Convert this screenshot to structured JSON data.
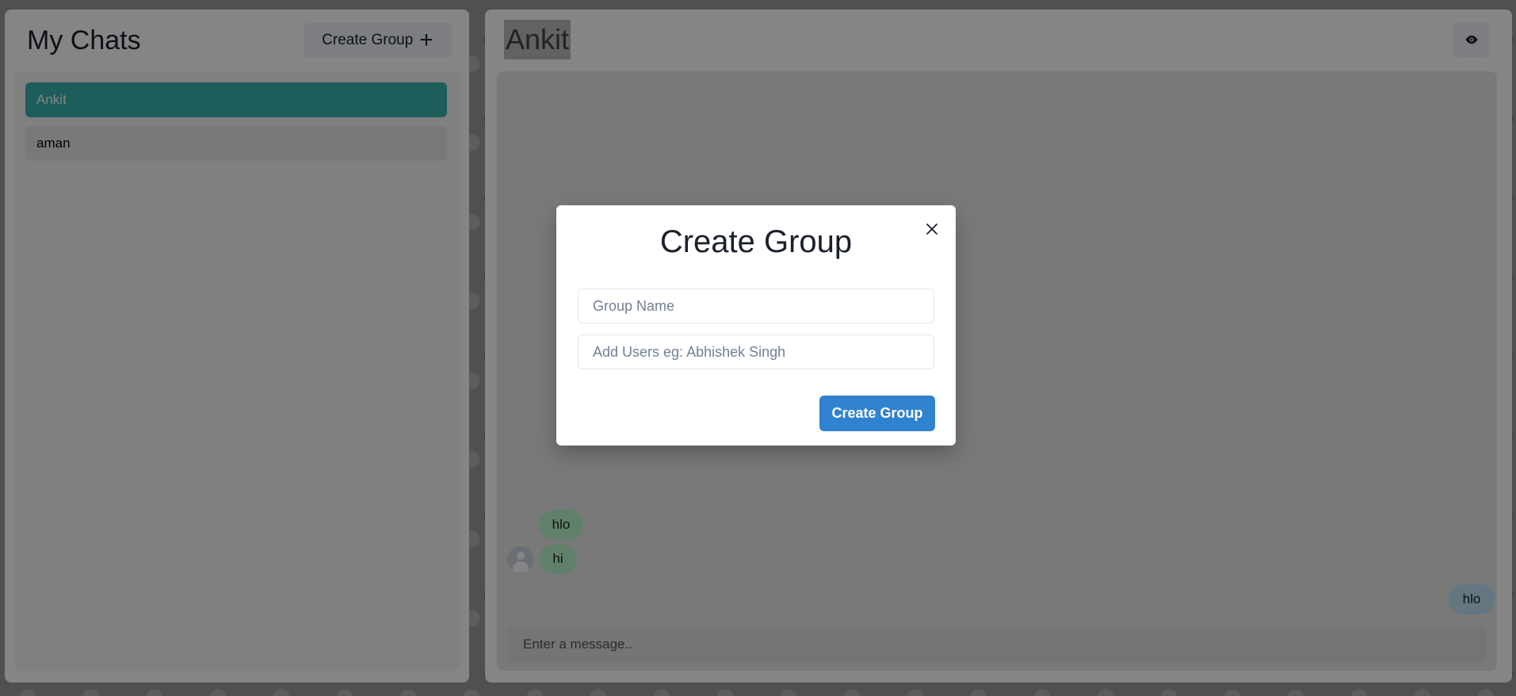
{
  "left_panel": {
    "title": "My Chats",
    "create_group_button": "Create Group",
    "create_group_icon": "+",
    "chats": [
      {
        "name": "Ankit",
        "active": true
      },
      {
        "name": "aman",
        "active": false
      }
    ]
  },
  "right_panel": {
    "chat_name": "Ankit",
    "view_profile_icon": "eye-icon",
    "messages": [
      {
        "text": "hlo",
        "direction": "incoming"
      },
      {
        "text": "hi",
        "direction": "incoming"
      },
      {
        "text": "hlo",
        "direction": "outgoing"
      }
    ],
    "input_placeholder": "Enter a message.."
  },
  "modal": {
    "title": "Create Group",
    "close_icon": "close-icon",
    "group_name_placeholder": "Group Name",
    "add_users_placeholder": "Add Users eg: Abhishek Singh",
    "submit_label": "Create Group"
  },
  "colors": {
    "active_chat": "#38b2ac",
    "incoming_bubble": "#b9f5d0",
    "outgoing_bubble": "#bee3f8",
    "primary_button": "#3182ce"
  }
}
